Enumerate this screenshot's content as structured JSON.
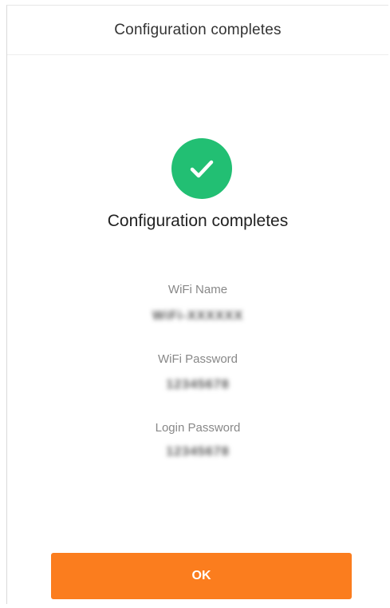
{
  "header": {
    "title": "Configuration completes"
  },
  "status": {
    "icon": "check-circle-icon",
    "color": "#22bf73",
    "title": "Configuration completes"
  },
  "fields": {
    "wifi_name": {
      "label": "WiFi Name",
      "value": "WiFi-XXXXXX"
    },
    "wifi_password": {
      "label": "WiFi Password",
      "value": "12345678"
    },
    "login_password": {
      "label": "Login Password",
      "value": "12345678"
    }
  },
  "actions": {
    "ok_label": "OK",
    "ok_color": "#fb7d1e"
  }
}
